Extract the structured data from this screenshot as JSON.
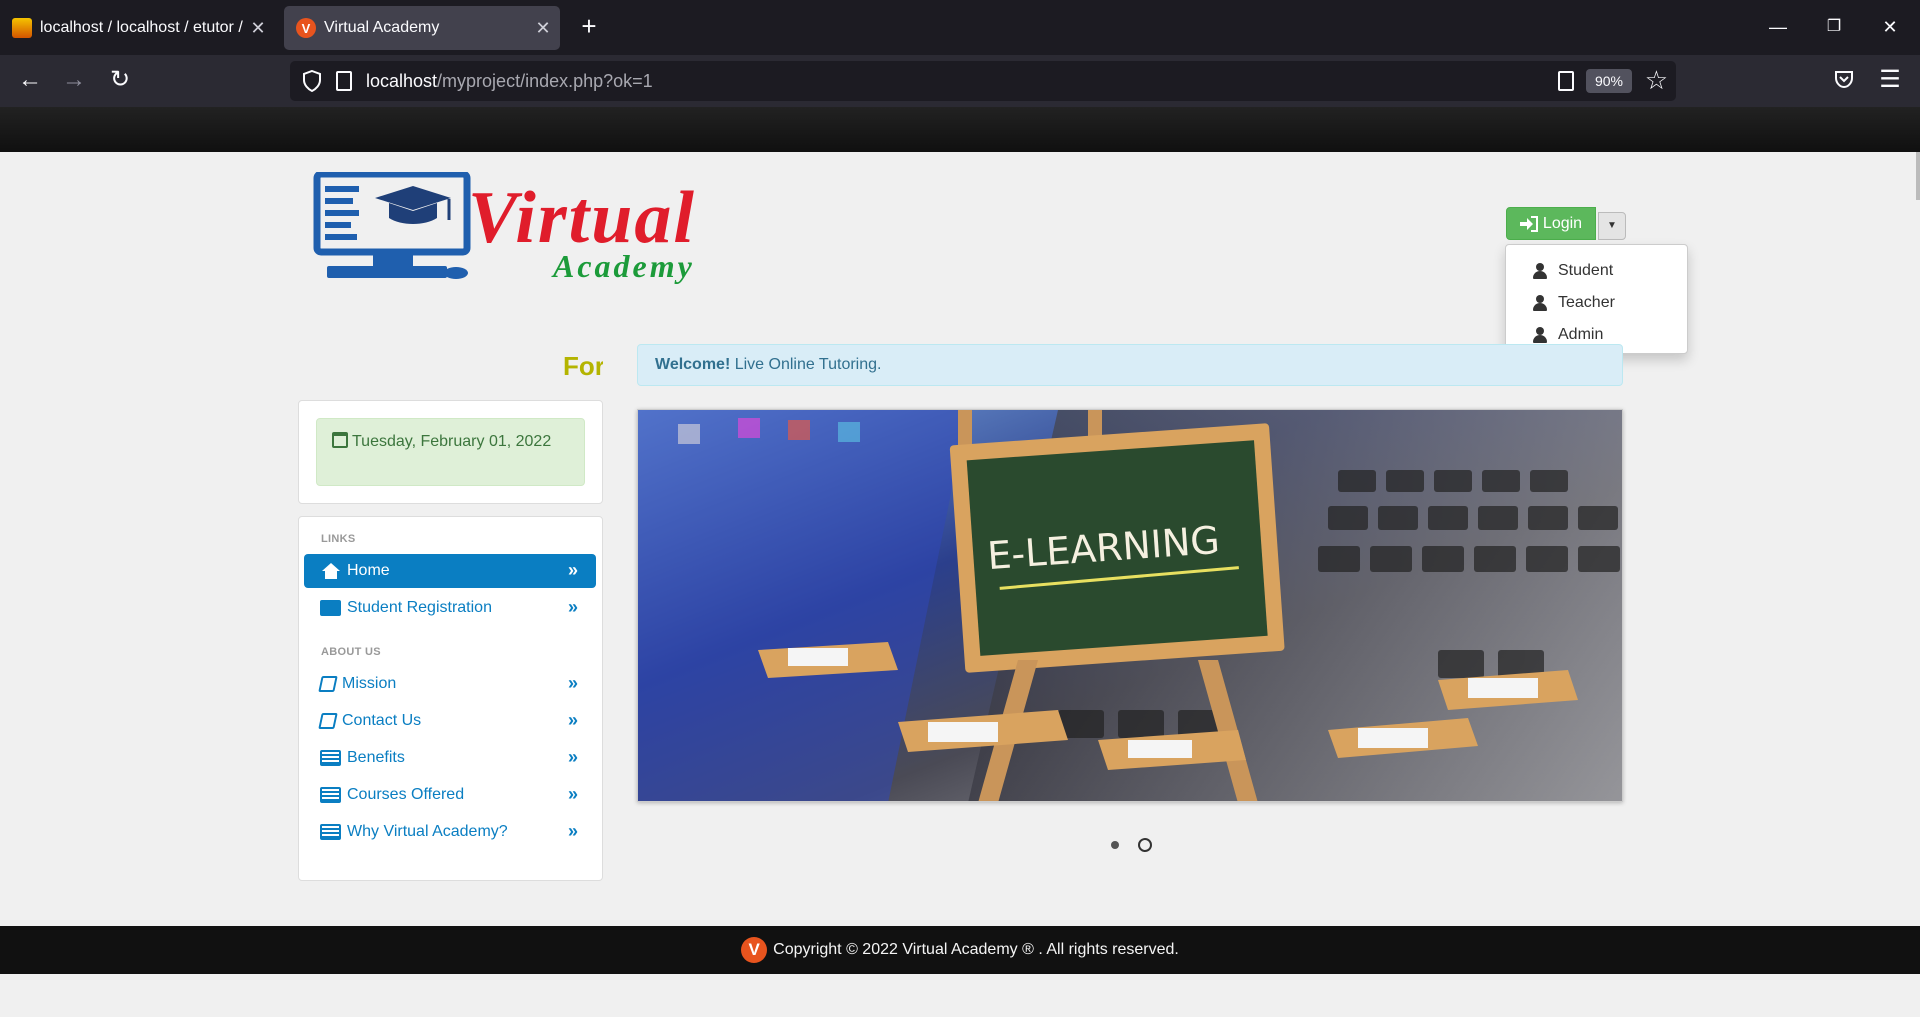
{
  "browser": {
    "tabs": [
      {
        "title": "localhost / localhost / etutor / tl",
        "active": false
      },
      {
        "title": "Virtual Academy",
        "active": true
      }
    ],
    "url_host": "localhost",
    "url_path": "/myproject/index.php?ok=1",
    "zoom": "90%"
  },
  "brand": {
    "logo_primary": "Virtual",
    "logo_secondary": "Academy"
  },
  "login": {
    "button_label": "Login",
    "menu": [
      {
        "label": "Student"
      },
      {
        "label": "Teacher"
      },
      {
        "label": "Admin"
      }
    ]
  },
  "marquee_text": "For",
  "welcome": {
    "strong": "Welcome!",
    "text": " Live Online Tutoring."
  },
  "date_text": "Tuesday, February 01, 2022",
  "sidebar": {
    "links_header": "LINKS",
    "links": [
      {
        "label": "Home",
        "active": true
      },
      {
        "label": "Student Registration"
      }
    ],
    "about_header": "ABOUT US",
    "about": [
      {
        "label": "Mission"
      },
      {
        "label": "Contact Us"
      },
      {
        "label": "Benefits"
      },
      {
        "label": "Courses Offered"
      },
      {
        "label": "Why Virtual Academy?"
      }
    ]
  },
  "carousel": {
    "slide_text": "E-LEARNING",
    "active_index": 0,
    "slide_count": 2
  },
  "footer": {
    "text": "Copyright © 2022 Virtual Academy ® . All rights reserved."
  },
  "colors": {
    "accent": "#0a7ec2",
    "login_green": "#5cb85c",
    "logo_red": "#e01d2b",
    "logo_green": "#1c9b3a"
  }
}
